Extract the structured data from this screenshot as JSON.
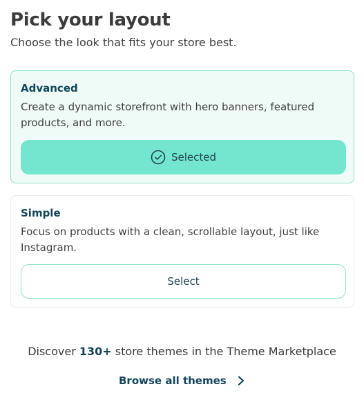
{
  "header": {
    "title": "Pick your layout",
    "subtitle": "Choose the look that fits your store best."
  },
  "layouts": [
    {
      "title": "Advanced",
      "description": "Create a dynamic storefront with hero banners, featured products, and more.",
      "button_label": "Selected",
      "state": "selected",
      "icon": "check-circle-icon"
    },
    {
      "title": "Simple",
      "description": "Focus on products with a clean, scrollable layout, just like Instagram.",
      "button_label": "Select",
      "state": "unselected"
    }
  ],
  "marketplace": {
    "prefix": "Discover",
    "count": "130+",
    "suffix": "store themes in the Theme Marketplace",
    "browse_label": "Browse all themes",
    "browse_icon": "chevron-right-icon"
  },
  "colors": {
    "accent": "#74e6cf",
    "accent_border": "#8fe3c9",
    "selected_card_bg": "#effbf7",
    "heading": "#12445a"
  }
}
